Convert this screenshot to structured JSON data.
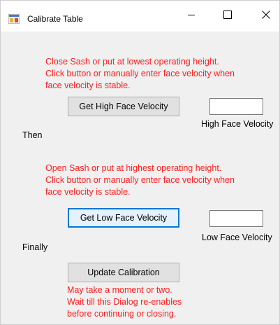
{
  "window": {
    "title": "Calibrate Table"
  },
  "instructions": {
    "high": [
      "Close Sash or put at lowest operating height.",
      "Click button or manually enter face velocity when",
      "face velocity is stable."
    ],
    "low": [
      "Open Sash or put at highest operating height.",
      "Click button or manually enter face velocity when",
      "face velocity is stable."
    ],
    "update": [
      "May take a moment or two.",
      "Wait till this Dialog re-enables",
      "before continuing or closing."
    ]
  },
  "buttons": {
    "get_high": "Get High Face Velocity",
    "get_low": "Get Low Face Velocity",
    "update": "Update Calibration"
  },
  "fields": {
    "high_value": "",
    "low_value": ""
  },
  "labels": {
    "high": "High Face Velocity",
    "low": "Low Face Velocity",
    "then": "Then",
    "finally": "Finally"
  },
  "colors": {
    "instruction_text": "#ff2020",
    "focus_border": "#0078d7"
  },
  "icons": {
    "app": "calibrate-table-app-icon",
    "minimize": "minimize-icon",
    "maximize": "maximize-icon",
    "close": "close-icon"
  }
}
